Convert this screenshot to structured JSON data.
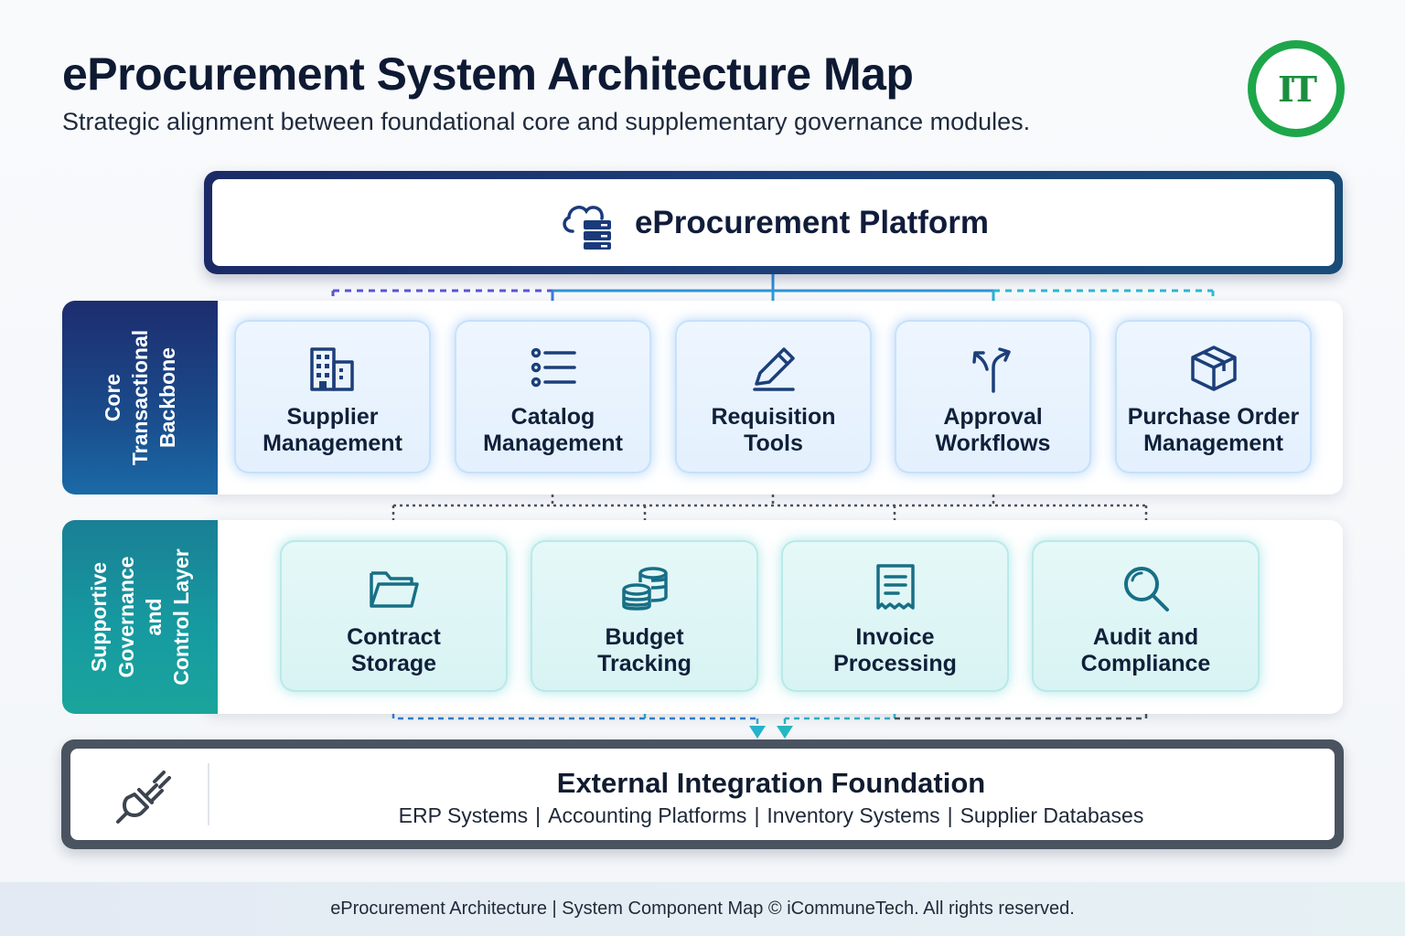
{
  "header": {
    "title": "eProcurement System Architecture Map",
    "subtitle": "Strategic alignment between foundational core and supplementary governance modules.",
    "logo_text": "IT"
  },
  "platform": {
    "title": "eProcurement Platform",
    "icon": "cloud-server-icon"
  },
  "core_layer": {
    "label": "Core\nTransactional\nBackbone",
    "modules": [
      {
        "label": "Supplier\nManagement",
        "icon": "building-icon"
      },
      {
        "label": "Catalog\nManagement",
        "icon": "list-icon"
      },
      {
        "label": "Requisition\nTools",
        "icon": "pencil-icon"
      },
      {
        "label": "Approval\nWorkflows",
        "icon": "split-arrow-icon"
      },
      {
        "label": "Purchase Order\nManagement",
        "icon": "package-icon"
      }
    ]
  },
  "support_layer": {
    "label": "Supportive\nGovernance and\nControl Layer",
    "modules": [
      {
        "label": "Contract\nStorage",
        "icon": "folder-icon"
      },
      {
        "label": "Budget\nTracking",
        "icon": "coins-icon"
      },
      {
        "label": "Invoice\nProcessing",
        "icon": "receipt-icon"
      },
      {
        "label": "Audit and\nCompliance",
        "icon": "magnifier-icon"
      }
    ]
  },
  "foundation": {
    "title": "External Integration Foundation",
    "icon": "plug-icon",
    "systems": [
      "ERP Systems",
      "Accounting Platforms",
      "Inventory Systems",
      "Supplier Databases"
    ]
  },
  "footer": {
    "text": "eProcurement Architecture | System Component Map © iCommuneTech. All rights reserved."
  },
  "colors": {
    "core_dark": "#1d2d6e",
    "core_accent": "#1a6aa6",
    "support_accent": "#16a0a0",
    "foundation_border": "#4a5360",
    "logo_green": "#1ea64a"
  }
}
